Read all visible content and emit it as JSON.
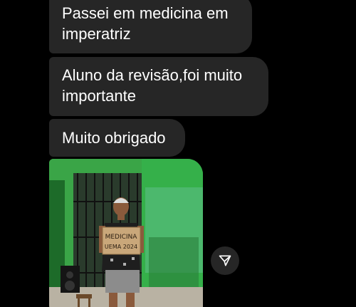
{
  "messages": [
    {
      "text": "Passei em medicina em imperatriz"
    },
    {
      "text": "Aluno da revisão,foi muito importante"
    },
    {
      "text": "Muito obrigado"
    }
  ],
  "photo": {
    "sign_line1": "MEDICINA",
    "sign_line2": "UEMA 2024"
  },
  "share": {
    "icon": "paper-plane-icon"
  },
  "colors": {
    "background": "#000000",
    "bubble": "#262626",
    "text": "#ffffff"
  }
}
